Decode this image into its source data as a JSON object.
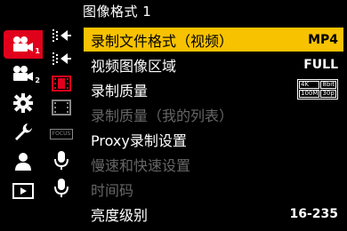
{
  "header": {
    "title": "图像格式 1"
  },
  "tabs": [
    {
      "name": "video-tab",
      "sub": "1",
      "active": true
    },
    {
      "name": "video-tab-2",
      "sub": "2",
      "active": false
    },
    {
      "name": "settings-gear",
      "sub": "",
      "active": false
    },
    {
      "name": "custom-wrench",
      "sub": "",
      "active": false
    },
    {
      "name": "my-menu-person",
      "sub": "",
      "active": false
    },
    {
      "name": "playback",
      "sub": "",
      "active": false
    }
  ],
  "subicons": [
    {
      "name": "image-format-icon",
      "selected": true
    },
    {
      "name": "image-format-2-icon",
      "selected": false
    },
    {
      "name": "film-icon",
      "selected": false
    },
    {
      "name": "film-2-icon",
      "selected": false
    },
    {
      "name": "focus-icon",
      "selected": false
    },
    {
      "name": "microphone-icon",
      "selected": false
    },
    {
      "name": "microphone-2-icon",
      "selected": false
    }
  ],
  "focus_label": "FOCUS",
  "menu": [
    {
      "label": "录制文件格式（视频）",
      "value": "MP4",
      "selected": true,
      "disabled": false
    },
    {
      "label": "视频图像区域",
      "value": "FULL",
      "selected": false,
      "disabled": false
    },
    {
      "label": "录制质量",
      "value": "",
      "badge": [
        "4K",
        "8bit",
        "100M",
        "30p"
      ],
      "selected": false,
      "disabled": false
    },
    {
      "label": "录制质量（我的列表）",
      "value": "",
      "selected": false,
      "disabled": true
    },
    {
      "label": "Proxy录制设置",
      "value": "",
      "selected": false,
      "disabled": false
    },
    {
      "label": "慢速和快速设置",
      "value": "",
      "selected": false,
      "disabled": true
    },
    {
      "label": "时间码",
      "value": "",
      "selected": false,
      "disabled": true
    },
    {
      "label": "亮度级别",
      "value": "16-235",
      "selected": false,
      "disabled": false
    }
  ],
  "colors": {
    "accent": "#e0001b",
    "highlight": "#f7c200",
    "disabled": "#666666"
  }
}
